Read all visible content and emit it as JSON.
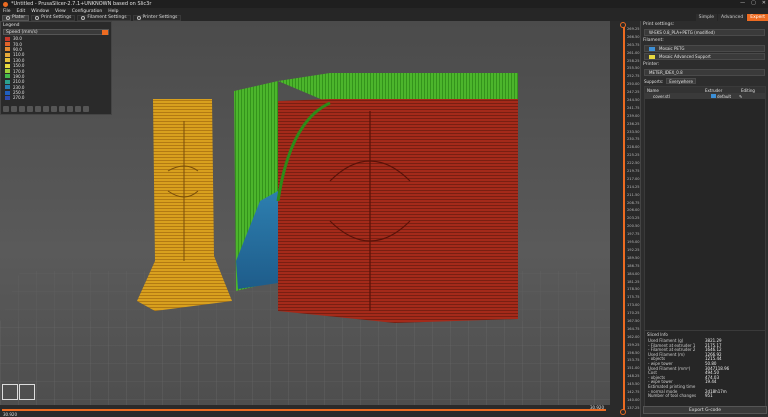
{
  "window": {
    "title": "*Untitled - PrusaSlicer-2.7.1+UNKNOWN based on Slic3r",
    "controls": [
      "—",
      "▢",
      "✕"
    ]
  },
  "menu": [
    "File",
    "Edit",
    "Window",
    "View",
    "Configuration",
    "Help"
  ],
  "tabs": [
    {
      "label": "Plater",
      "active": true
    },
    {
      "label": "Print Settings"
    },
    {
      "label": "Filament Settings"
    },
    {
      "label": "Printer Settings"
    }
  ],
  "modes": [
    {
      "label": "Simple"
    },
    {
      "label": "Advanced"
    },
    {
      "label": "Expert",
      "active": true
    }
  ],
  "legend": {
    "title": "Legend",
    "view_type": "Speed (mm/s)",
    "items": [
      {
        "value": "30.0",
        "color": "#c8392b"
      },
      {
        "value": "70.0",
        "color": "#e2632a"
      },
      {
        "value": "90.0",
        "color": "#e58a31"
      },
      {
        "value": "110.0",
        "color": "#e5a83a"
      },
      {
        "value": "130.0",
        "color": "#e6c13c"
      },
      {
        "value": "150.0",
        "color": "#e8d83f"
      },
      {
        "value": "170.0",
        "color": "#9ccf3c"
      },
      {
        "value": "190.0",
        "color": "#43b84b"
      },
      {
        "value": "210.0",
        "color": "#2ba28d"
      },
      {
        "value": "230.0",
        "color": "#267fb2"
      },
      {
        "value": "250.0",
        "color": "#1f5fbf"
      },
      {
        "value": "270.0",
        "color": "#2e4ab0"
      }
    ]
  },
  "viewport": {
    "bottom_left": "30.920",
    "bottom_right": "30.920"
  },
  "layer_ticks": [
    "269.25",
    "266.50",
    "263.75",
    "261.00",
    "258.25",
    "255.50",
    "252.75",
    "250.00",
    "247.25",
    "244.50",
    "241.75",
    "239.00",
    "236.25",
    "233.50",
    "230.75",
    "228.00",
    "225.25",
    "222.50",
    "219.75",
    "217.00",
    "214.25",
    "211.50",
    "208.75",
    "206.00",
    "203.25",
    "200.50",
    "197.75",
    "195.00",
    "192.25",
    "189.50",
    "186.75",
    "184.00",
    "181.25",
    "178.50",
    "175.75",
    "173.00",
    "170.25",
    "167.50",
    "164.75",
    "162.00",
    "159.25",
    "156.50",
    "153.75",
    "151.00",
    "148.25",
    "145.50",
    "142.75",
    "140.00",
    "137.25"
  ],
  "sidebar": {
    "print_settings_label": "Print settings:",
    "print_profile": "W-EKS 0.8_PLA+PETG (modified)",
    "filament_label": "Filament:",
    "filaments": [
      {
        "name": "Mosaic PETG",
        "color": "#3c8fd6"
      },
      {
        "name": "Mosaic Advanced Support",
        "color": "#e8d83f"
      }
    ],
    "printer_label": "Printer:",
    "printer": "METER_IDEX_0.8",
    "supports_label": "Supports:",
    "supports": "Everywhere",
    "infill_label": "Infill:",
    "infill": "20%",
    "brim_label": "Brim:",
    "obj_headers": [
      "Name",
      "Extruder",
      "Editing"
    ],
    "objects": [
      {
        "name": "cover.stl",
        "extruder": "default"
      }
    ],
    "sliced_title": "Sliced Info",
    "sliced": [
      {
        "k": "Used Filament (g)",
        "v": "3821.29"
      },
      {
        "k": "  - Filament at extruder 1",
        "v": "2175.17"
      },
      {
        "k": "  - Filament at extruder 2",
        "v": "1646.12"
      },
      {
        "k": "Used Filament (m)",
        "v": "1266.92"
      },
      {
        "k": "  - objects",
        "v": "1215.44"
      },
      {
        "k": "  - wipe tower",
        "v": "50.80"
      },
      {
        "k": "Used Filament (mm³)",
        "v": "3047118.96"
      },
      {
        "k": "Cost",
        "v": "494.50"
      },
      {
        "k": "  - objects",
        "v": "474.03"
      },
      {
        "k": "  - wipe tower",
        "v": "19.44"
      },
      {
        "k": "Estimated printing time",
        "v": ""
      },
      {
        "k": "  - normal mode",
        "v": "2d18h17m"
      },
      {
        "k": "Number of tool changes",
        "v": "951"
      }
    ],
    "export_label": "Export G-code"
  }
}
